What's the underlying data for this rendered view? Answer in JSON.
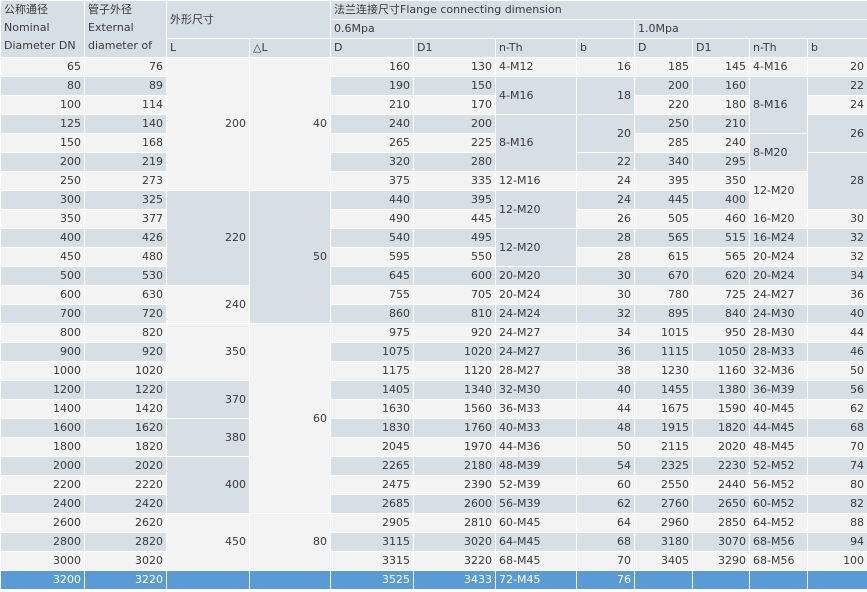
{
  "header": {
    "dn_lines": [
      "公称通径",
      "Nominal",
      "Diameter DN"
    ],
    "od_lines": [
      "管子外径",
      "External",
      "diameter of"
    ],
    "outer_dim": "外形尺寸",
    "flange_dim": "法兰连接尺寸Flange connecting dimension",
    "p1": "0.6Mpa",
    "p2": "1.0Mpa",
    "col_L": "L",
    "col_dL": "△L",
    "col_D": "D",
    "col_D1": "D1",
    "col_nTh": "n-Th",
    "col_b": "b"
  },
  "rows": [
    {
      "dn": "65",
      "od": "76",
      "d_a": "160",
      "d1_a": "130",
      "nth_a": "4-M12",
      "b_a": "16",
      "d_b": "185",
      "d1_b": "145",
      "nth_b": "4-M16",
      "b_b": "20"
    },
    {
      "dn": "80",
      "od": "89",
      "d_a": "190",
      "d1_a": "150",
      "nth_a": "4-M16",
      "b_a": "18",
      "d_b": "200",
      "d1_b": "160",
      "nth_b": "",
      "b_b": "22"
    },
    {
      "dn": "100",
      "od": "114",
      "d_a": "210",
      "d1_a": "170",
      "nth_a": "",
      "b_a": "",
      "d_b": "220",
      "d1_b": "180",
      "nth_b": "8-M16",
      "b_b": "24"
    },
    {
      "dn": "125",
      "od": "140",
      "d_a": "240",
      "d1_a": "200",
      "nth_a": "8-M16",
      "b_a": "20",
      "d_b": "250",
      "d1_b": "210",
      "nth_b": "",
      "b_b": "26"
    },
    {
      "dn": "150",
      "od": "168",
      "d_a": "265",
      "d1_a": "225",
      "nth_a": "",
      "b_a": "",
      "d_b": "285",
      "d1_b": "240",
      "nth_b": "8-M20",
      "b_b": ""
    },
    {
      "dn": "200",
      "od": "219",
      "d_a": "320",
      "d1_a": "280",
      "nth_a": "",
      "b_a": "22",
      "d_b": "340",
      "d1_b": "295",
      "nth_b": "",
      "b_b": "28"
    },
    {
      "dn": "250",
      "od": "273",
      "d_a": "375",
      "d1_a": "335",
      "nth_a": "12-M16",
      "b_a": "24",
      "d_b": "395",
      "d1_b": "350",
      "nth_b": "12-M20",
      "b_b": ""
    },
    {
      "dn": "300",
      "od": "325",
      "d_a": "440",
      "d1_a": "395",
      "nth_a": "12-M20",
      "b_a": "24",
      "d_b": "445",
      "d1_b": "400",
      "nth_b": "",
      "b_b": ""
    },
    {
      "dn": "350",
      "od": "377",
      "d_a": "490",
      "d1_a": "445",
      "nth_a": "",
      "b_a": "26",
      "d_b": "505",
      "d1_b": "460",
      "nth_b": "16-M20",
      "b_b": "30"
    },
    {
      "dn": "400",
      "od": "426",
      "d_a": "540",
      "d1_a": "495",
      "nth_a": "12-M20",
      "b_a": "28",
      "d_b": "565",
      "d1_b": "515",
      "nth_b": "16-M24",
      "b_b": "32"
    },
    {
      "dn": "450",
      "od": "480",
      "d_a": "595",
      "d1_a": "550",
      "nth_a": "",
      "b_a": "28",
      "d_b": "615",
      "d1_b": "565",
      "nth_b": "20-M24",
      "b_b": "32"
    },
    {
      "dn": "500",
      "od": "530",
      "d_a": "645",
      "d1_a": "600",
      "nth_a": "20-M20",
      "b_a": "30",
      "d_b": "670",
      "d1_b": "620",
      "nth_b": "20-M24",
      "b_b": "34"
    },
    {
      "dn": "600",
      "od": "630",
      "d_a": "755",
      "d1_a": "705",
      "nth_a": "20-M24",
      "b_a": "30",
      "d_b": "780",
      "d1_b": "725",
      "nth_b": "24-M27",
      "b_b": "36"
    },
    {
      "dn": "700",
      "od": "720",
      "d_a": "860",
      "d1_a": "810",
      "nth_a": "24-M24",
      "b_a": "32",
      "d_b": "895",
      "d1_b": "840",
      "nth_b": "24-M30",
      "b_b": "40"
    },
    {
      "dn": "800",
      "od": "820",
      "d_a": "975",
      "d1_a": "920",
      "nth_a": "24-M27",
      "b_a": "34",
      "d_b": "1015",
      "d1_b": "950",
      "nth_b": "28-M30",
      "b_b": "44"
    },
    {
      "dn": "900",
      "od": "920",
      "d_a": "1075",
      "d1_a": "1020",
      "nth_a": "24-M27",
      "b_a": "36",
      "d_b": "1115",
      "d1_b": "1050",
      "nth_b": "28-M33",
      "b_b": "46"
    },
    {
      "dn": "1000",
      "od": "1020",
      "d_a": "1175",
      "d1_a": "1120",
      "nth_a": "28-M27",
      "b_a": "38",
      "d_b": "1230",
      "d1_b": "1160",
      "nth_b": "32-M36",
      "b_b": "50"
    },
    {
      "dn": "1200",
      "od": "1220",
      "d_a": "1405",
      "d1_a": "1340",
      "nth_a": "32-M30",
      "b_a": "40",
      "d_b": "1455",
      "d1_b": "1380",
      "nth_b": "36-M39",
      "b_b": "56"
    },
    {
      "dn": "1400",
      "od": "1420",
      "d_a": "1630",
      "d1_a": "1560",
      "nth_a": "36-M33",
      "b_a": "44",
      "d_b": "1675",
      "d1_b": "1590",
      "nth_b": "40-M45",
      "b_b": "62"
    },
    {
      "dn": "1600",
      "od": "1620",
      "d_a": "1830",
      "d1_a": "1760",
      "nth_a": "40-M33",
      "b_a": "48",
      "d_b": "1915",
      "d1_b": "1820",
      "nth_b": "44-M45",
      "b_b": "68"
    },
    {
      "dn": "1800",
      "od": "1820",
      "d_a": "2045",
      "d1_a": "1970",
      "nth_a": "44-M36",
      "b_a": "50",
      "d_b": "2115",
      "d1_b": "2020",
      "nth_b": "48-M45",
      "b_b": "70"
    },
    {
      "dn": "2000",
      "od": "2020",
      "d_a": "2265",
      "d1_a": "2180",
      "nth_a": "48-M39",
      "b_a": "54",
      "d_b": "2325",
      "d1_b": "2230",
      "nth_b": "52-M52",
      "b_b": "74"
    },
    {
      "dn": "2200",
      "od": "2220",
      "d_a": "2475",
      "d1_a": "2390",
      "nth_a": "52-M39",
      "b_a": "60",
      "d_b": "2550",
      "d1_b": "2440",
      "nth_b": "56-M52",
      "b_b": "80"
    },
    {
      "dn": "2400",
      "od": "2420",
      "d_a": "2685",
      "d1_a": "2600",
      "nth_a": "56-M39",
      "b_a": "62",
      "d_b": "2760",
      "d1_b": "2650",
      "nth_b": "60-M52",
      "b_b": "82"
    },
    {
      "dn": "2600",
      "od": "2620",
      "d_a": "2905",
      "d1_a": "2810",
      "nth_a": "60-M45",
      "b_a": "64",
      "d_b": "2960",
      "d1_b": "2850",
      "nth_b": "64-M52",
      "b_b": "88"
    },
    {
      "dn": "2800",
      "od": "2820",
      "d_a": "3115",
      "d1_a": "3020",
      "nth_a": "64-M45",
      "b_a": "68",
      "d_b": "3180",
      "d1_b": "3070",
      "nth_b": "68-M56",
      "b_b": "94"
    },
    {
      "dn": "3000",
      "od": "3020",
      "d_a": "3315",
      "d1_a": "3220",
      "nth_a": "68-M45",
      "b_a": "70",
      "d_b": "3405",
      "d1_b": "3290",
      "nth_b": "68-M56",
      "b_b": "100"
    },
    {
      "dn": "3200",
      "od": "3220",
      "d_a": "3525",
      "d1_a": "3433",
      "nth_a": "72-M45",
      "b_a": "76",
      "d_b": "",
      "d1_b": "",
      "nth_b": "",
      "b_b": ""
    }
  ],
  "merged": {
    "L_200": "200",
    "L_220": "220",
    "L_240": "240",
    "L_350": "350",
    "L_370": "370",
    "L_380": "380",
    "L_400": "400",
    "L_450": "450",
    "dL_40": "40",
    "dL_50": "50",
    "dL_60": "60",
    "dL_80": "80"
  },
  "colors": {
    "band_dark": "#d6dee6",
    "band_light": "#f3f3f3",
    "selected_row": "#5b9bd5"
  }
}
